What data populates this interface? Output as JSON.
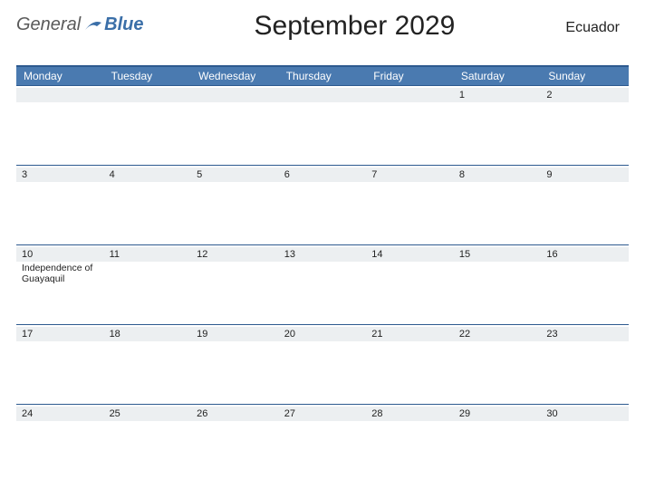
{
  "logo": {
    "general": "General",
    "blue": "Blue"
  },
  "title": "September 2029",
  "country": "Ecuador",
  "day_headers": [
    "Monday",
    "Tuesday",
    "Wednesday",
    "Thursday",
    "Friday",
    "Saturday",
    "Sunday"
  ],
  "weeks": [
    [
      {
        "num": "",
        "event": ""
      },
      {
        "num": "",
        "event": ""
      },
      {
        "num": "",
        "event": ""
      },
      {
        "num": "",
        "event": ""
      },
      {
        "num": "",
        "event": ""
      },
      {
        "num": "1",
        "event": ""
      },
      {
        "num": "2",
        "event": ""
      }
    ],
    [
      {
        "num": "3",
        "event": ""
      },
      {
        "num": "4",
        "event": ""
      },
      {
        "num": "5",
        "event": ""
      },
      {
        "num": "6",
        "event": ""
      },
      {
        "num": "7",
        "event": ""
      },
      {
        "num": "8",
        "event": ""
      },
      {
        "num": "9",
        "event": ""
      }
    ],
    [
      {
        "num": "10",
        "event": "Independence of Guayaquil"
      },
      {
        "num": "11",
        "event": ""
      },
      {
        "num": "12",
        "event": ""
      },
      {
        "num": "13",
        "event": ""
      },
      {
        "num": "14",
        "event": ""
      },
      {
        "num": "15",
        "event": ""
      },
      {
        "num": "16",
        "event": ""
      }
    ],
    [
      {
        "num": "17",
        "event": ""
      },
      {
        "num": "18",
        "event": ""
      },
      {
        "num": "19",
        "event": ""
      },
      {
        "num": "20",
        "event": ""
      },
      {
        "num": "21",
        "event": ""
      },
      {
        "num": "22",
        "event": ""
      },
      {
        "num": "23",
        "event": ""
      }
    ],
    [
      {
        "num": "24",
        "event": ""
      },
      {
        "num": "25",
        "event": ""
      },
      {
        "num": "26",
        "event": ""
      },
      {
        "num": "27",
        "event": ""
      },
      {
        "num": "28",
        "event": ""
      },
      {
        "num": "29",
        "event": ""
      },
      {
        "num": "30",
        "event": ""
      }
    ]
  ]
}
